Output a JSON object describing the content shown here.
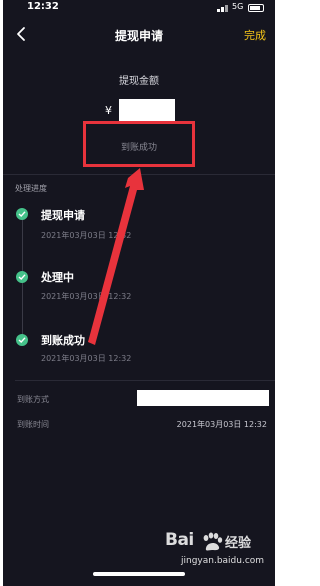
{
  "status_bar": {
    "time": "12:32",
    "network": "5G"
  },
  "nav": {
    "title": "提现申请",
    "done_label": "完成"
  },
  "amount": {
    "label": "提现金额",
    "currency_symbol": "¥",
    "status": "到账成功"
  },
  "progress": {
    "section_title": "处理进度",
    "steps": [
      {
        "title": "提现申请",
        "time": "2021年03月03日 12:32"
      },
      {
        "title": "处理中",
        "time": "2021年03月03日 12:32"
      },
      {
        "title": "到账成功",
        "time": "2021年03月03日 12:32"
      }
    ]
  },
  "info": {
    "method_label": "到账方式",
    "time_label": "到账时间",
    "time_value": "2021年03月03日 12:32"
  },
  "watermark": {
    "logo_text": "Bai",
    "brand": "经验",
    "url": "jingyan.baidu.com"
  },
  "colors": {
    "background": "#15151f",
    "accent": "#f5c518",
    "success": "#45c28a",
    "annotation": "#e8333c"
  }
}
